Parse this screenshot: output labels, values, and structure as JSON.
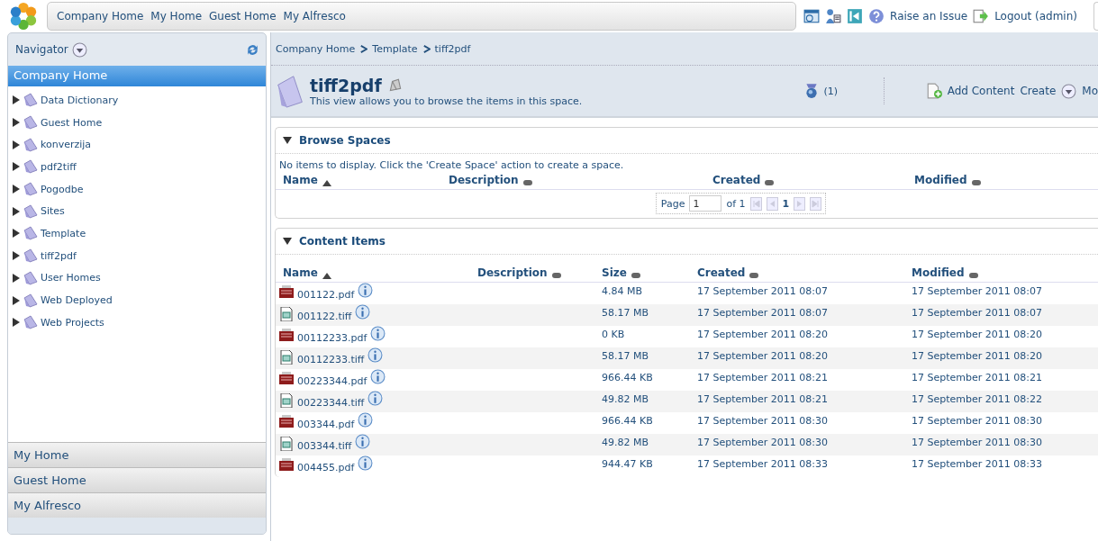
{
  "top_nav": {
    "links": [
      "Company Home",
      "My Home",
      "Guest Home",
      "My Alfresco"
    ]
  },
  "toolbar": {
    "links": [
      "Raise an Issue",
      "Logout (admin)"
    ]
  },
  "navigator": {
    "title": "Navigator",
    "root": "Company Home",
    "items": [
      {
        "label": "Data Dictionary",
        "expanded": false
      },
      {
        "label": "Guest Home",
        "expanded": false
      },
      {
        "label": "konverzija",
        "expanded": false
      },
      {
        "label": "pdf2tiff",
        "expanded": false
      },
      {
        "label": "Pogodbe",
        "expanded": false
      },
      {
        "label": "Sites",
        "expanded": false
      },
      {
        "label": "Template",
        "expanded": false
      },
      {
        "label": "tiff2pdf",
        "expanded": false
      },
      {
        "label": "User Homes",
        "expanded": false
      },
      {
        "label": "Web Deployed",
        "expanded": false
      },
      {
        "label": "Web Projects",
        "expanded": false
      }
    ],
    "shelves": [
      "My Home",
      "Guest Home",
      "My Alfresco"
    ]
  },
  "breadcrumb": [
    "Company Home",
    "Template",
    "tiff2pdf"
  ],
  "space": {
    "title": "tiff2pdf",
    "description": "This view allows you to browse the items in this space.",
    "rules_count": "(1)",
    "actions": [
      {
        "kind": "add",
        "label": "Add Content"
      },
      {
        "kind": "menu",
        "label": "Create"
      },
      {
        "kind": "plain",
        "label": "Mo"
      }
    ]
  },
  "browse_spaces": {
    "title": "Browse Spaces",
    "expanded": true,
    "message": "No items to display. Click the 'Create Space' action to create a space.",
    "columns": [
      {
        "label": "Name",
        "sorted": true
      },
      {
        "label": "Description",
        "sorted": false
      },
      {
        "label": "Created",
        "sorted": false
      },
      {
        "label": "Modified",
        "sorted": false
      }
    ],
    "pager": {
      "page_label": "Page",
      "page": "1",
      "of": "of 1",
      "current": "1"
    }
  },
  "content_items": {
    "title": "Content Items",
    "expanded": true,
    "columns": [
      {
        "label": "Name",
        "sorted": true
      },
      {
        "label": "Description",
        "sorted": false
      },
      {
        "label": "Size",
        "sorted": false
      },
      {
        "label": "Created",
        "sorted": false
      },
      {
        "label": "Modified",
        "sorted": false
      }
    ],
    "rows": [
      {
        "kind": "pdf",
        "name": "001122.pdf",
        "size": "4.84 MB",
        "created": "17 September 2011 08:07",
        "modified": "17 September 2011 08:07"
      },
      {
        "kind": "tiff",
        "name": "001122.tiff",
        "size": "58.17 MB",
        "created": "17 September 2011 08:07",
        "modified": "17 September 2011 08:07"
      },
      {
        "kind": "pdf",
        "name": "00112233.pdf",
        "size": "0 KB",
        "created": "17 September 2011 08:20",
        "modified": "17 September 2011 08:20"
      },
      {
        "kind": "tiff",
        "name": "00112233.tiff",
        "size": "58.17 MB",
        "created": "17 September 2011 08:20",
        "modified": "17 September 2011 08:20"
      },
      {
        "kind": "pdf",
        "name": "00223344.pdf",
        "size": "966.44 KB",
        "created": "17 September 2011 08:21",
        "modified": "17 September 2011 08:21"
      },
      {
        "kind": "tiff",
        "name": "00223344.tiff",
        "size": "49.82 MB",
        "created": "17 September 2011 08:21",
        "modified": "17 September 2011 08:22"
      },
      {
        "kind": "pdf",
        "name": "003344.pdf",
        "size": "966.44 KB",
        "created": "17 September 2011 08:30",
        "modified": "17 September 2011 08:30"
      },
      {
        "kind": "tiff",
        "name": "003344.tiff",
        "size": "49.82 MB",
        "created": "17 September 2011 08:30",
        "modified": "17 September 2011 08:30"
      },
      {
        "kind": "pdf",
        "name": "004455.pdf",
        "size": "944.47 KB",
        "created": "17 September 2011 08:33",
        "modified": "17 September 2011 08:33"
      }
    ]
  }
}
